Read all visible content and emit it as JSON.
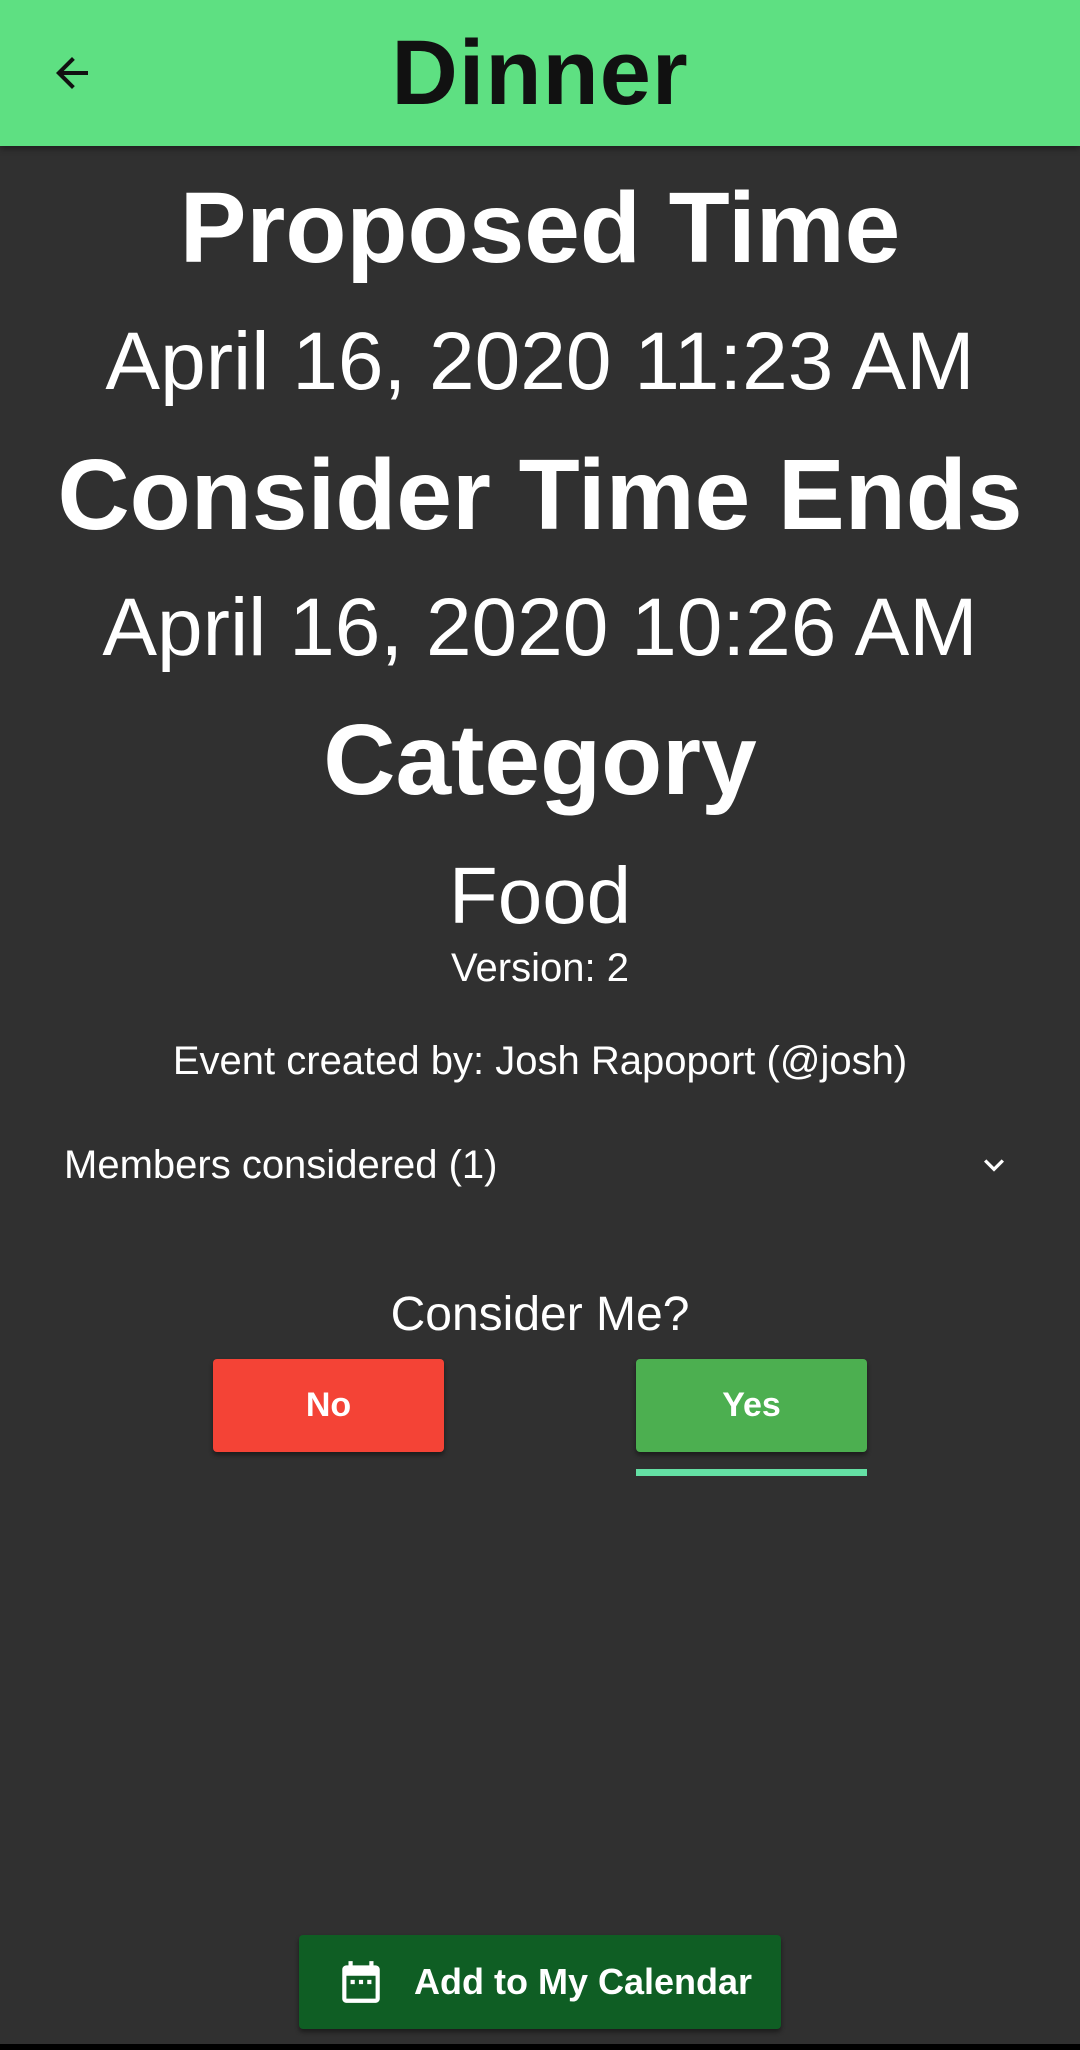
{
  "appbar": {
    "title": "Dinner",
    "back_icon": "arrow-back-icon",
    "background": "#5ee082"
  },
  "event": {
    "proposed_time_heading": "Proposed Time",
    "proposed_time_value": "April 16, 2020 11:23 AM",
    "consider_ends_heading": "Consider Time Ends",
    "consider_ends_value": "April 16, 2020 10:26 AM",
    "category_heading": "Category",
    "category_value": "Food",
    "version_text": "Version: 2",
    "creator_text": "Event created by: Josh Rapoport (@josh)"
  },
  "members": {
    "label": "Members considered (1)",
    "expand_icon": "chevron-down-icon"
  },
  "consider": {
    "question": "Consider Me?",
    "no_label": "No",
    "yes_label": "Yes",
    "no_color": "#f44336",
    "yes_color": "#4caf50",
    "selected": "Yes",
    "indicator_color": "#64e0a4"
  },
  "calendar_button": {
    "label": "Add to My Calendar",
    "icon": "calendar-icon",
    "color": "#0f5e24"
  },
  "colors": {
    "background": "#303030",
    "text": "#ffffff"
  }
}
